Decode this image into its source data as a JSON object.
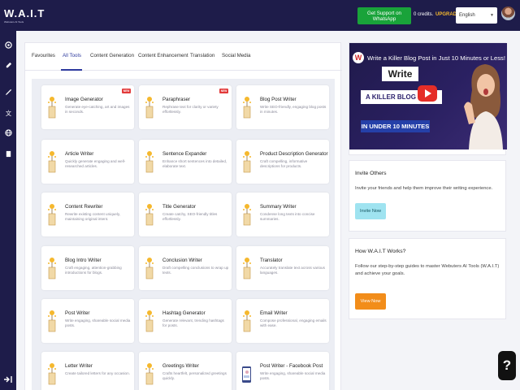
{
  "app": {
    "logo_text": "W.A.I.T",
    "logo_tagline": "Webuters AI Tools"
  },
  "header": {
    "whatsapp_label": "Get Support on WhatsApp",
    "credits_label": "0 credits.",
    "upgrade_label": "UPGRADE",
    "language_value": "English"
  },
  "sidebar": {
    "icons": [
      "dashboard-icon",
      "rocket-icon",
      "pen-icon",
      "translate-icon",
      "globe-icon",
      "document-icon"
    ]
  },
  "tabs": [
    "Favourites",
    "All Tools",
    "Content Generation",
    "Content Enhancement",
    "Translation",
    "Social Media"
  ],
  "active_tab": "All Tools",
  "cards": [
    {
      "title": "Image Generator",
      "desc": "Generate eye-catching, art and images in seconds.",
      "badge": "NEW"
    },
    {
      "title": "Paraphraser",
      "desc": "Rephrase text for clarity or variety effortlessly.",
      "badge": "NEW"
    },
    {
      "title": "Blog Post Writer",
      "desc": "Write SEO-friendly, engaging blog posts in minutes.",
      "badge": ""
    },
    {
      "title": "Article Writer",
      "desc": "Quickly generate engaging and well-researched articles.",
      "badge": ""
    },
    {
      "title": "Sentence Expander",
      "desc": "Enhance short sentences into detailed, elaborate text.",
      "badge": ""
    },
    {
      "title": "Product Description Generator",
      "desc": "Craft compelling, informative descriptions for products.",
      "badge": ""
    },
    {
      "title": "Content Rewriter",
      "desc": "Rewrite existing content uniquely, maintaining original intent.",
      "badge": ""
    },
    {
      "title": "Title Generator",
      "desc": "Create catchy, SEO-friendly titles effortlessly.",
      "badge": ""
    },
    {
      "title": "Summary Writer",
      "desc": "Condense long texts into concise summaries.",
      "badge": ""
    },
    {
      "title": "Blog Intro Writer",
      "desc": "Craft engaging, attention-grabbing introductions for blogs.",
      "badge": ""
    },
    {
      "title": "Conclusion Writer",
      "desc": "Draft compelling conclusions to wrap up texts.",
      "badge": ""
    },
    {
      "title": "Translator",
      "desc": "Accurately translate text across various languages.",
      "badge": ""
    },
    {
      "title": "Post Writer",
      "desc": "Write engaging, shareable social media posts.",
      "badge": ""
    },
    {
      "title": "Hashtag Generator",
      "desc": "Generate relevant, trending hashtags for posts.",
      "badge": ""
    },
    {
      "title": "Email Writer",
      "desc": "Compose professional, engaging emails with ease.",
      "badge": ""
    },
    {
      "title": "Letter Writer",
      "desc": "Create tailored letters for any occasion.",
      "badge": ""
    },
    {
      "title": "Greetings Writer",
      "desc": "Crafts heartfelt, personalized greetings quickly.",
      "badge": ""
    },
    {
      "title": "Post Writer - Facebook Post",
      "desc": "Write engaging, shareable social media posts.",
      "badge": ""
    }
  ],
  "video": {
    "title": "Write a Killer Blog Post in Just 10 Minutes or Less!",
    "write": "Write",
    "killer": "A KILLER BLOG PO",
    "minutes": "IN UNDER 10 MINUTES"
  },
  "invite": {
    "title": "Invite Others",
    "text": "Invite your friends and help them improve their writing experience.",
    "button": "Invite Now"
  },
  "howto": {
    "title": "How W.A.I.T Works?",
    "text": "Follow our step-by-step guides to master Webuters AI Tools (W.A.I.T) and achieve your goals.",
    "button": "View Now"
  },
  "help_label": "?"
}
